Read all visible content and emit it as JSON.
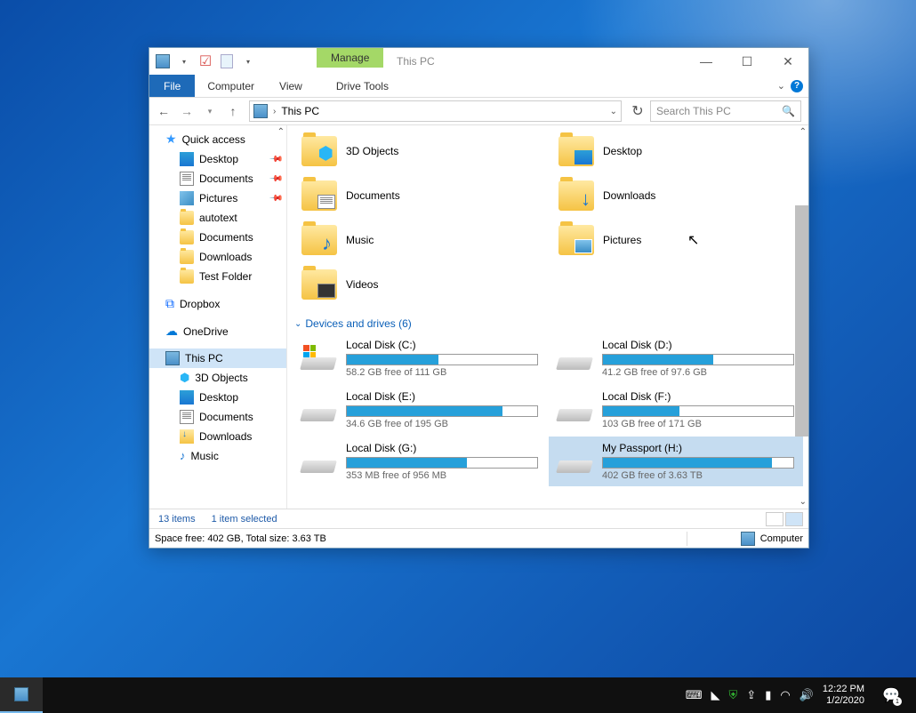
{
  "window": {
    "title": "This PC",
    "manage_tab": "Manage",
    "tabs": {
      "file": "File",
      "computer": "Computer",
      "view": "View",
      "drive_tools": "Drive Tools"
    }
  },
  "address": {
    "location": "This PC"
  },
  "search": {
    "placeholder": "Search This PC"
  },
  "nav_pane": {
    "quick_access": "Quick access",
    "qa_items": [
      "Desktop",
      "Documents",
      "Pictures",
      "autotext",
      "Documents",
      "Downloads",
      "Test Folder"
    ],
    "dropbox": "Dropbox",
    "onedrive": "OneDrive",
    "this_pc": "This PC",
    "pc_items": [
      "3D Objects",
      "Desktop",
      "Documents",
      "Downloads",
      "Music"
    ]
  },
  "folders": [
    {
      "name": "3D Objects"
    },
    {
      "name": "Desktop"
    },
    {
      "name": "Documents"
    },
    {
      "name": "Downloads"
    },
    {
      "name": "Music"
    },
    {
      "name": "Pictures"
    },
    {
      "name": "Videos"
    }
  ],
  "section_drives": "Devices and drives (6)",
  "drives": [
    {
      "name": "Local Disk (C:)",
      "free": "58.2 GB free of 111 GB",
      "pct": 48,
      "win": true
    },
    {
      "name": "Local Disk (D:)",
      "free": "41.2 GB free of 97.6 GB",
      "pct": 58
    },
    {
      "name": "Local Disk (E:)",
      "free": "34.6 GB free of 195 GB",
      "pct": 82
    },
    {
      "name": "Local Disk (F:)",
      "free": "103 GB free of 171 GB",
      "pct": 40
    },
    {
      "name": "Local Disk (G:)",
      "free": "353 MB free of 956 MB",
      "pct": 63
    },
    {
      "name": "My Passport (H:)",
      "free": "402 GB free of 3.63 TB",
      "pct": 89,
      "selected": true
    }
  ],
  "status": {
    "items": "13 items",
    "selected": "1 item selected"
  },
  "details": {
    "left": "Space free: 402 GB, Total size: 3.63 TB",
    "right": "Computer"
  },
  "tray": {
    "time": "12:22 PM",
    "date": "1/2/2020",
    "badge": "1"
  }
}
